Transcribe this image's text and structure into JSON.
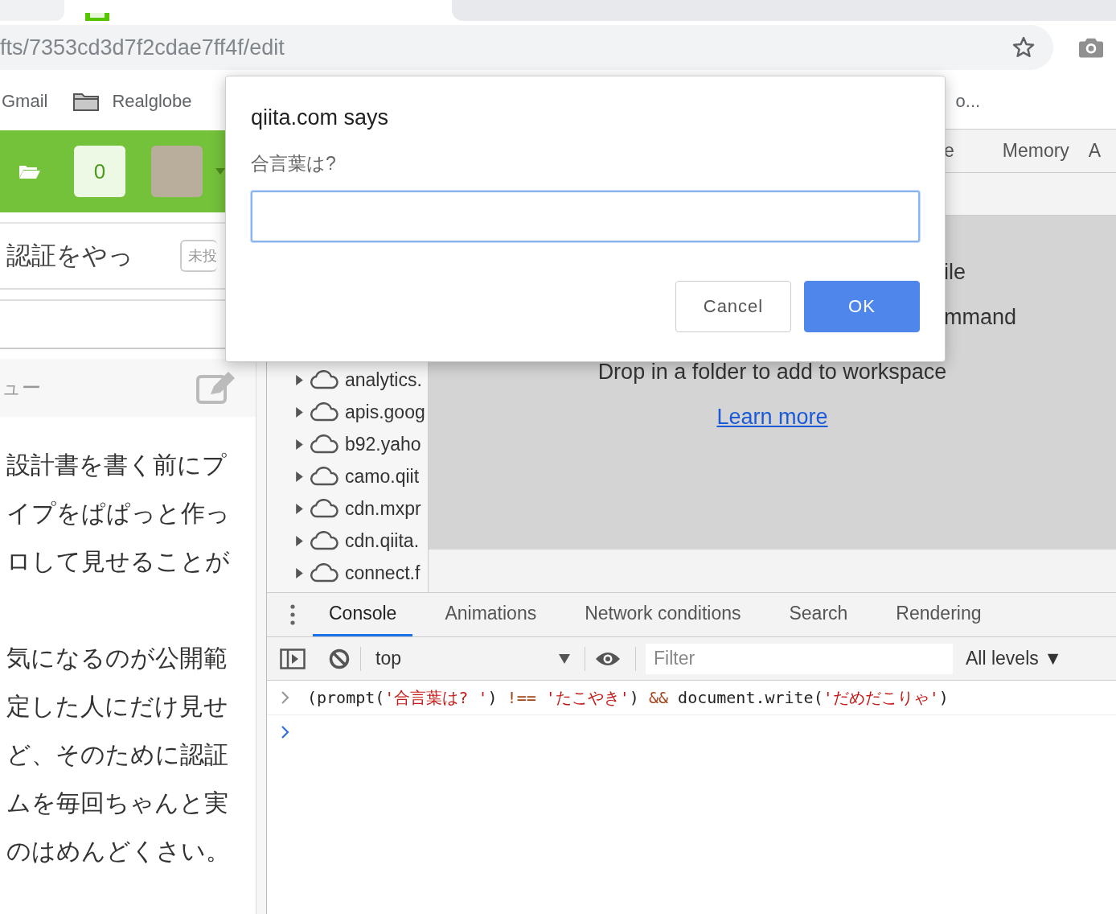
{
  "address_bar": {
    "url": "fts/7353cd3d7f2cdae7ff4f/edit"
  },
  "bookmarks": [
    {
      "label": "Gmail",
      "kind": "link"
    },
    {
      "label": "Realglobe",
      "kind": "folder"
    },
    {
      "label": "o...",
      "kind": "link"
    }
  ],
  "page": {
    "notification_count": "0",
    "title": "認証をやっ",
    "status_badge": "未投",
    "preview_label": "ュー",
    "paragraphs": [
      [
        "設計書を書く前にプ",
        "イプをぱぱっと作っ",
        "ロして見せることが"
      ],
      [
        "気になるのが公開範",
        "定した人にだけ見せ",
        "ど、そのために認証",
        "ムを毎回ちゃんと実",
        "のはめんどくさい。"
      ]
    ]
  },
  "devtools": {
    "panel_tabs": [
      {
        "label": "e",
        "selected": false
      },
      {
        "label": "Memory",
        "selected": false
      },
      {
        "label": "A",
        "selected": false
      }
    ],
    "navigator": [
      "analytics.",
      "apis.goog",
      "b92.yaho",
      "camo.qiit",
      "cdn.mxpr",
      "cdn.qiita.",
      "connect.f"
    ],
    "workspace": {
      "fragments": [
        "ile",
        "mmand"
      ],
      "hint": "Drop in a folder to add to workspace",
      "link": "Learn more"
    },
    "drawer_tabs": [
      {
        "label": "Console",
        "selected": true
      },
      {
        "label": "Animations",
        "selected": false
      },
      {
        "label": "Network conditions",
        "selected": false
      },
      {
        "label": "Search",
        "selected": false
      },
      {
        "label": "Rendering",
        "selected": false
      }
    ],
    "console_toolbar": {
      "context": "top",
      "filter_placeholder": "Filter",
      "levels": "All levels ▼"
    },
    "console": [
      {
        "kind": "input",
        "tokens": [
          {
            "kind": "plain",
            "text": "(prompt("
          },
          {
            "kind": "string",
            "text": "'合言葉は? '"
          },
          {
            "kind": "plain",
            "text": ") "
          },
          {
            "kind": "operator",
            "text": "!== "
          },
          {
            "kind": "string",
            "text": "'たこやき'"
          },
          {
            "kind": "plain",
            "text": ") "
          },
          {
            "kind": "operator",
            "text": "&&"
          },
          {
            "kind": "plain",
            "text": " document.write("
          },
          {
            "kind": "string",
            "text": "'だめだこりゃ'"
          },
          {
            "kind": "plain",
            "text": ")"
          }
        ]
      },
      {
        "kind": "prompt"
      }
    ]
  },
  "dialog": {
    "title": "qiita.com says",
    "message": "合言葉は?",
    "buttons": [
      {
        "label": "Cancel",
        "primary": false
      },
      {
        "label": "OK",
        "primary": true
      }
    ]
  }
}
